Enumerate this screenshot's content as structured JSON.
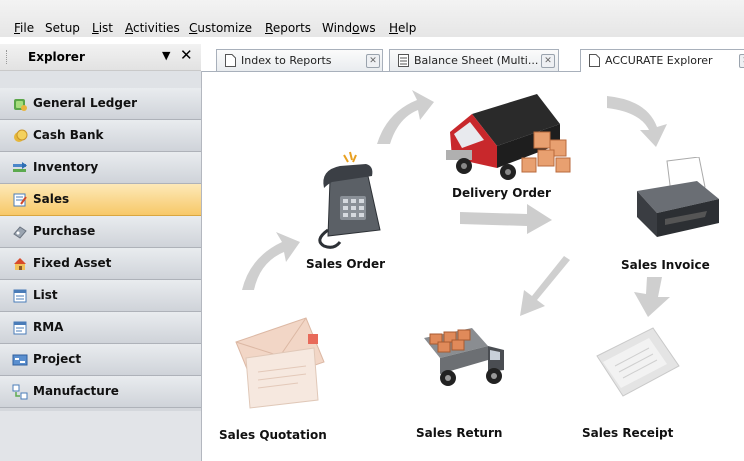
{
  "menu": [
    {
      "label": "File",
      "underline": "F",
      "rest": "ile"
    },
    {
      "label": "Setup",
      "underline": "",
      "rest": "Setup"
    },
    {
      "label": "List",
      "underline": "L",
      "rest": "ist"
    },
    {
      "label": "Activities",
      "underline": "A",
      "rest": "ctivities"
    },
    {
      "label": "Customize",
      "underline": "C",
      "rest": "ustomize"
    },
    {
      "label": "Reports",
      "underline": "R",
      "rest": "eports"
    },
    {
      "label": "Windows",
      "pre": "Wind",
      "underline": "o",
      "rest": "ws"
    },
    {
      "label": "Help",
      "underline": "H",
      "rest": "elp"
    }
  ],
  "explorer": {
    "title": "Explorer",
    "pin_icon": "▼",
    "close_icon": "✕"
  },
  "sidebar": {
    "items": [
      {
        "label": "General Ledger",
        "icon": "ledger-icon",
        "active": false
      },
      {
        "label": "Cash Bank",
        "icon": "cash-bank-icon",
        "active": false
      },
      {
        "label": "Inventory",
        "icon": "inventory-icon",
        "active": false
      },
      {
        "label": "Sales",
        "icon": "sales-icon",
        "active": true
      },
      {
        "label": "Purchase",
        "icon": "purchase-icon",
        "active": false
      },
      {
        "label": "Fixed Asset",
        "icon": "fixed-asset-icon",
        "active": false
      },
      {
        "label": "List",
        "icon": "list-icon",
        "active": false
      },
      {
        "label": "RMA",
        "icon": "rma-icon",
        "active": false
      },
      {
        "label": "Project",
        "icon": "project-icon",
        "active": false
      },
      {
        "label": "Manufacture",
        "icon": "manufacture-icon",
        "active": false
      }
    ]
  },
  "tabs": [
    {
      "label": "Index to Reports",
      "active": false
    },
    {
      "label": "Balance Sheet (Multi...",
      "active": false
    },
    {
      "label": "ACCURATE Explorer",
      "active": true
    }
  ],
  "flow": {
    "sales_order": "Sales Order",
    "delivery_order": "Delivery Order",
    "sales_invoice": "Sales Invoice",
    "sales_quotation": "Sales Quotation",
    "sales_return": "Sales Return",
    "sales_receipt": "Sales Receipt"
  },
  "colors": {
    "active_item": "#f7c868",
    "sidebar_bg": "#d4d7dc",
    "arrow": "#c8c8c8"
  }
}
